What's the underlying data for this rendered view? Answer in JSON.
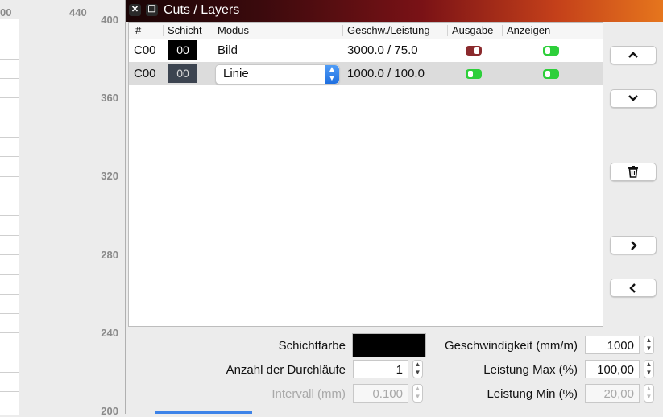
{
  "ruler": {
    "top_labels": [
      "00",
      "440"
    ],
    "side_labels": [
      "400",
      "360",
      "320",
      "280",
      "240",
      "200"
    ]
  },
  "window": {
    "title": "Cuts / Layers",
    "close_icon": "close-icon",
    "restore_icon": "restore-icon"
  },
  "table": {
    "headers": [
      "#",
      "Schicht",
      "Modus",
      "Geschw./Leistung",
      "Ausgabe",
      "Anzeigen"
    ],
    "rows": [
      {
        "id": "C00",
        "layer": "00",
        "layer_color": "#000000",
        "mode": "Bild",
        "speed_power": "3000.0 / 75.0",
        "output_on": false,
        "show_on": true
      },
      {
        "id": "C00",
        "layer": "00",
        "layer_color": "#3c4450",
        "mode": "Linie",
        "speed_power": "1000.0 / 100.0",
        "output_on": true,
        "show_on": true
      }
    ]
  },
  "side_buttons": {
    "up": "⌃",
    "down": "⌄",
    "delete": "🗑",
    "right": "›",
    "left": "‹"
  },
  "settings": {
    "layer_color_label": "Schichtfarbe",
    "layer_color_value": "#000000",
    "passes_label": "Anzahl der Durchläufe",
    "passes_value": "1",
    "interval_label": "Intervall (mm)",
    "interval_value": "0.100",
    "speed_label": "Geschwindigkeit (mm/m)",
    "speed_value": "1000",
    "power_max_label": "Leistung Max (%)",
    "power_max_value": "100,00",
    "power_min_label": "Leistung Min (%)",
    "power_min_value": "20,00"
  },
  "colors": {
    "toggle_on": "#2dcf3a",
    "toggle_off": "#8b2a2d",
    "accent": "#1f6fe0"
  }
}
